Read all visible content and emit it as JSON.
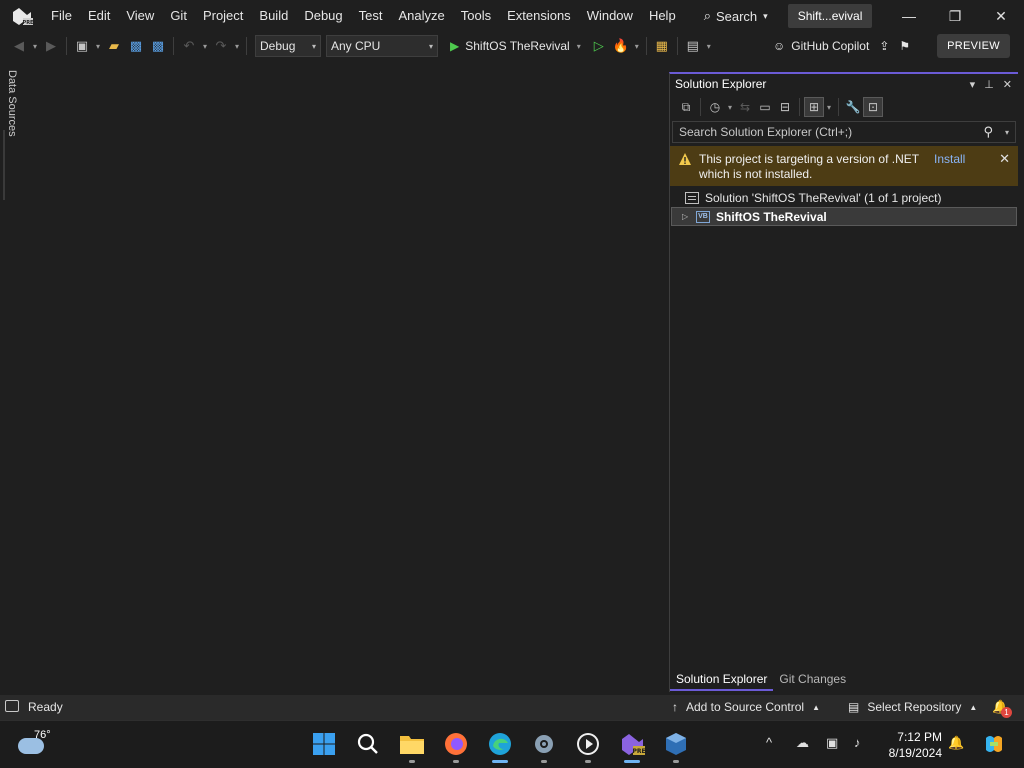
{
  "menu": {
    "items": [
      "File",
      "Edit",
      "View",
      "Git",
      "Project",
      "Build",
      "Debug",
      "Test",
      "Analyze",
      "Tools",
      "Extensions",
      "Window",
      "Help"
    ],
    "search_label": "Search",
    "title_pill": "Shift...evival"
  },
  "toolbar": {
    "config": "Debug",
    "platform": "Any CPU",
    "run_target": "ShiftOS TheRevival",
    "copilot_label": "GitHub Copilot",
    "preview_label": "PREVIEW"
  },
  "left_tab": {
    "label": "Data Sources"
  },
  "solution_explorer": {
    "title": "Solution Explorer",
    "search_placeholder": "Search Solution Explorer (Ctrl+;)",
    "warning": {
      "text": "This project is targeting a version of .NET which is not installed.",
      "action": "Install"
    },
    "tree": {
      "solution": "Solution 'ShiftOS TheRevival' (1 of 1 project)",
      "project": "ShiftOS TheRevival",
      "project_icon_label": "VB"
    },
    "tabs": [
      "Solution Explorer",
      "Git Changes"
    ]
  },
  "statusbar": {
    "ready": "Ready",
    "add_to_source": "Add to Source Control",
    "select_repo": "Select Repository",
    "notification_count": "1"
  },
  "taskbar": {
    "weather_temp": "76°",
    "time": "7:12 PM",
    "date": "8/19/2024"
  },
  "colors": {
    "accent": "#6b5bd6",
    "warning_bg": "#4d3c14",
    "link": "#89b4f5",
    "run_green": "#4ec94e"
  }
}
